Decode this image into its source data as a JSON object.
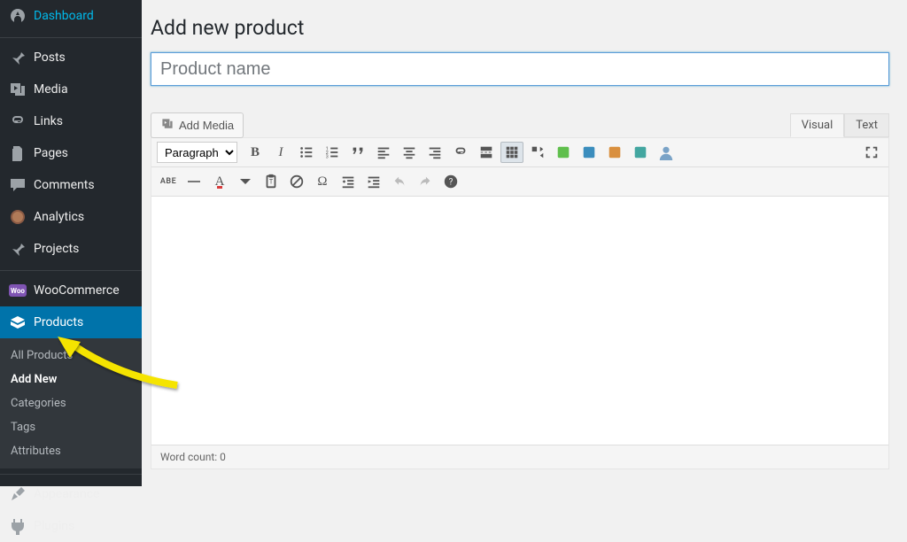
{
  "sidebar": {
    "items": [
      {
        "label": "Dashboard"
      },
      {
        "label": "Posts"
      },
      {
        "label": "Media"
      },
      {
        "label": "Links"
      },
      {
        "label": "Pages"
      },
      {
        "label": "Comments"
      },
      {
        "label": "Analytics"
      },
      {
        "label": "Projects"
      },
      {
        "label": "WooCommerce"
      },
      {
        "label": "Products"
      },
      {
        "label": "Appearance"
      },
      {
        "label": "Plugins"
      }
    ],
    "products_submenu": [
      {
        "label": "All Products"
      },
      {
        "label": "Add New"
      },
      {
        "label": "Categories"
      },
      {
        "label": "Tags"
      },
      {
        "label": "Attributes"
      }
    ]
  },
  "page": {
    "title": "Add new product",
    "title_placeholder": "Product name"
  },
  "editor": {
    "add_media": "Add Media",
    "tab_visual": "Visual",
    "tab_text": "Text",
    "format_select": "Paragraph",
    "word_count": "Word count: 0"
  }
}
